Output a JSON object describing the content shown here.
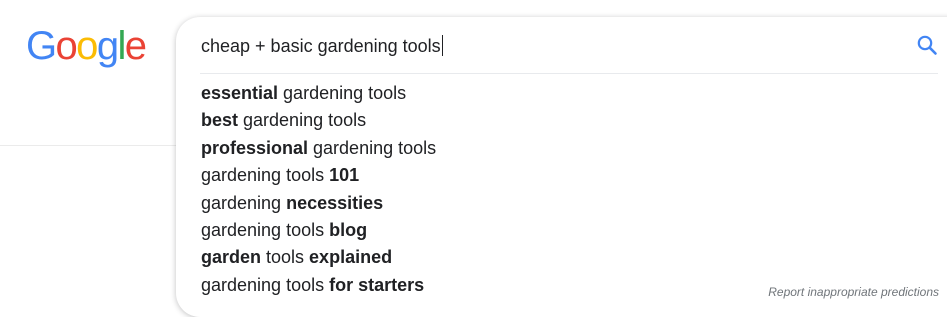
{
  "logo": {
    "text": "Google",
    "letters": [
      {
        "ch": "G",
        "color": "#4285F4"
      },
      {
        "ch": "o",
        "color": "#EA4335"
      },
      {
        "ch": "o",
        "color": "#FBBC05"
      },
      {
        "ch": "g",
        "color": "#4285F4"
      },
      {
        "ch": "l",
        "color": "#34A853"
      },
      {
        "ch": "e",
        "color": "#EA4335"
      }
    ]
  },
  "search": {
    "query": "cheap + basic gardening tools",
    "icon": "search-icon",
    "icon_color": "#4285F4"
  },
  "suggestions": [
    {
      "parts": [
        {
          "t": "essential",
          "b": true
        },
        {
          "t": " gardening tools",
          "b": false
        }
      ]
    },
    {
      "parts": [
        {
          "t": "best",
          "b": true
        },
        {
          "t": " gardening tools",
          "b": false
        }
      ]
    },
    {
      "parts": [
        {
          "t": "professional",
          "b": true
        },
        {
          "t": " gardening tools",
          "b": false
        }
      ]
    },
    {
      "parts": [
        {
          "t": "gardening tools ",
          "b": false
        },
        {
          "t": "101",
          "b": true
        }
      ]
    },
    {
      "parts": [
        {
          "t": "gardening ",
          "b": false
        },
        {
          "t": "necessities",
          "b": true
        }
      ]
    },
    {
      "parts": [
        {
          "t": "gardening tools ",
          "b": false
        },
        {
          "t": "blog",
          "b": true
        }
      ]
    },
    {
      "parts": [
        {
          "t": "garden",
          "b": true
        },
        {
          "t": " tools ",
          "b": false
        },
        {
          "t": "explained",
          "b": true
        }
      ]
    },
    {
      "parts": [
        {
          "t": "gardening tools ",
          "b": false
        },
        {
          "t": "for starters",
          "b": true
        }
      ]
    }
  ],
  "report_link": "Report inappropriate predictions"
}
